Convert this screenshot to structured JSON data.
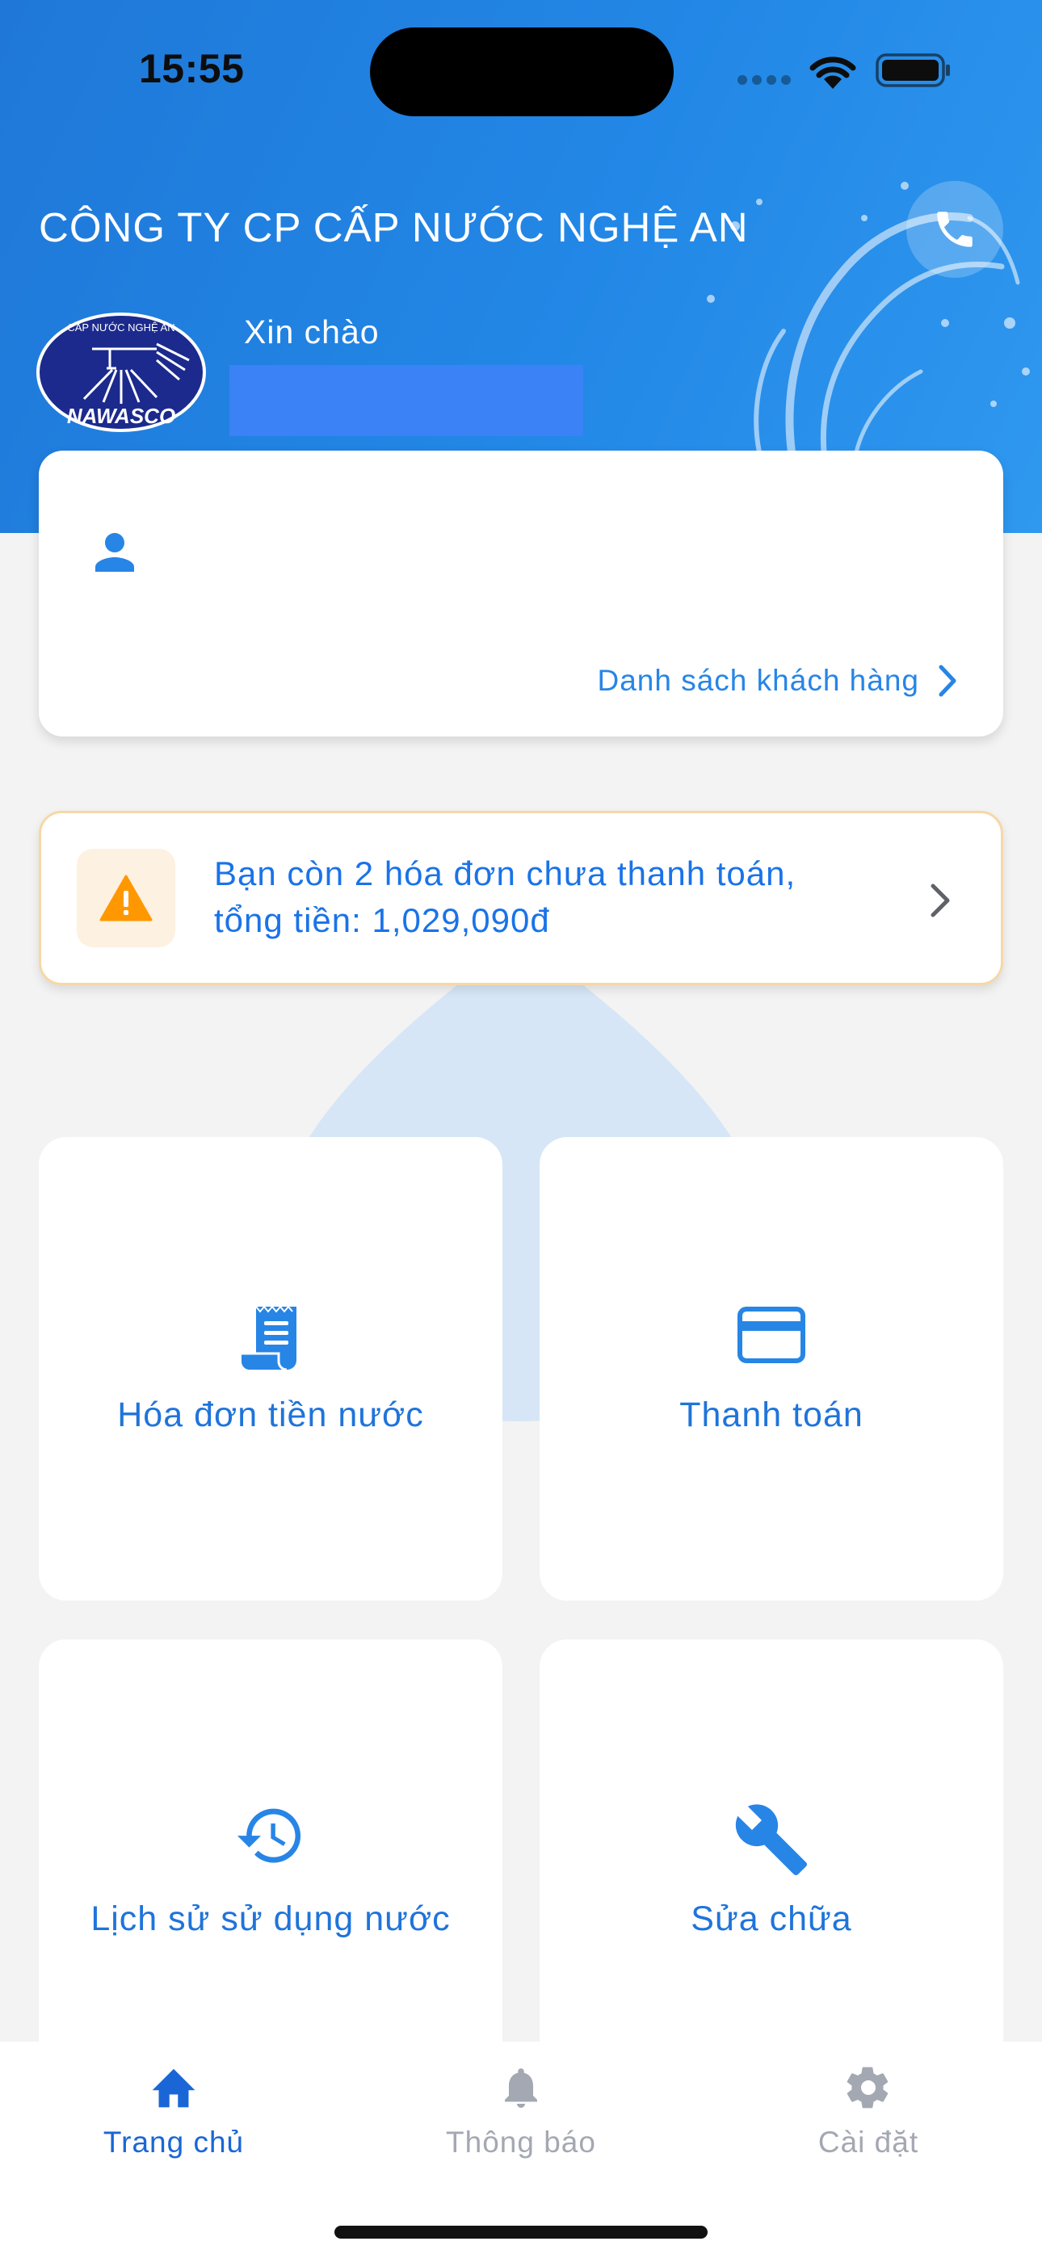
{
  "status_bar": {
    "time": "15:55"
  },
  "header": {
    "company_name": "CÔNG TY CP CẤP NƯỚC NGHỆ AN",
    "greeting": "Xin chào",
    "logo": {
      "top_text": "CẤP NƯỚC NGHỆ AN",
      "bottom_text": "NAWASCO"
    }
  },
  "customer_card": {
    "link_label": "Danh sách khách hàng"
  },
  "alert": {
    "line1": "Bạn còn 2 hóa đơn chưa thanh toán,",
    "line2": "tổng tiền: 1,029,090đ"
  },
  "tiles": [
    {
      "label": "Hóa đơn tiền nước",
      "icon": "receipt-icon"
    },
    {
      "label": "Thanh toán",
      "icon": "credit-card-icon"
    },
    {
      "label": "Lịch sử sử dụng nước",
      "icon": "history-icon"
    },
    {
      "label": "Sửa chữa",
      "icon": "wrench-icon"
    }
  ],
  "tabbar": {
    "items": [
      {
        "label": "Trang chủ",
        "icon": "home-icon",
        "active": true
      },
      {
        "label": "Thông báo",
        "icon": "bell-icon",
        "active": false
      },
      {
        "label": "Cài đặt",
        "icon": "gear-icon",
        "active": false
      }
    ]
  },
  "colors": {
    "header_gradient_start": "#1f78d8",
    "header_gradient_end": "#2f98ef",
    "accent": "#1f74da",
    "tab_active": "#1a66d6",
    "tab_inactive": "#a3a8b2",
    "warning": "#ff9800"
  }
}
